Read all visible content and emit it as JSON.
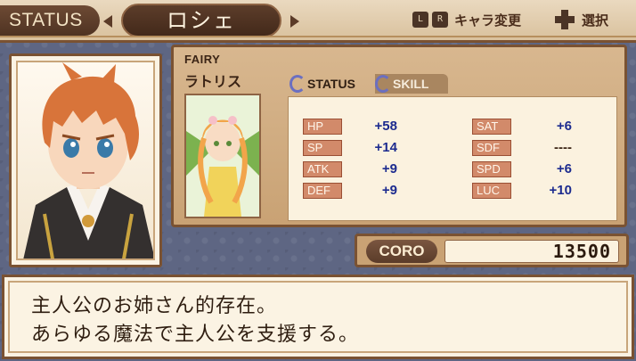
{
  "header": {
    "status_label": "STATUS",
    "character_name": "ロシェ",
    "key_l": "L",
    "key_r": "R",
    "change_character_label": "キャラ変更",
    "select_label": "選択"
  },
  "fairy": {
    "type_label": "FAIRY",
    "name": "ラトリス"
  },
  "tabs": [
    {
      "label": "STATUS"
    },
    {
      "label": "SKILL"
    }
  ],
  "stats": {
    "left": [
      {
        "label": "HP",
        "value": "+58"
      },
      {
        "label": "SP",
        "value": "+14"
      },
      {
        "label": "ATK",
        "value": "+9"
      },
      {
        "label": "DEF",
        "value": "+9"
      }
    ],
    "right": [
      {
        "label": "SAT",
        "value": "+6"
      },
      {
        "label": "SDF",
        "value": "----"
      },
      {
        "label": "SPD",
        "value": "+6"
      },
      {
        "label": "LUC",
        "value": "+10"
      }
    ]
  },
  "coro": {
    "label": "CORO",
    "value": "13500"
  },
  "description": {
    "line1": "主人公のお姉さん的存在。",
    "line2": "あらゆる魔法で主人公を支援する。"
  },
  "colors": {
    "frame_brown": "#7a5232",
    "panel_tan": "#c9a274",
    "stat_value_blue": "#1c2b8f",
    "stat_label_red": "#d28a6a",
    "background_slate": "#5e6683"
  },
  "icons": {
    "prev": "triangle-left-icon",
    "next": "triangle-right-icon",
    "dpad": "dpad-icon",
    "tab_marker": "ring-bracket-icon"
  }
}
